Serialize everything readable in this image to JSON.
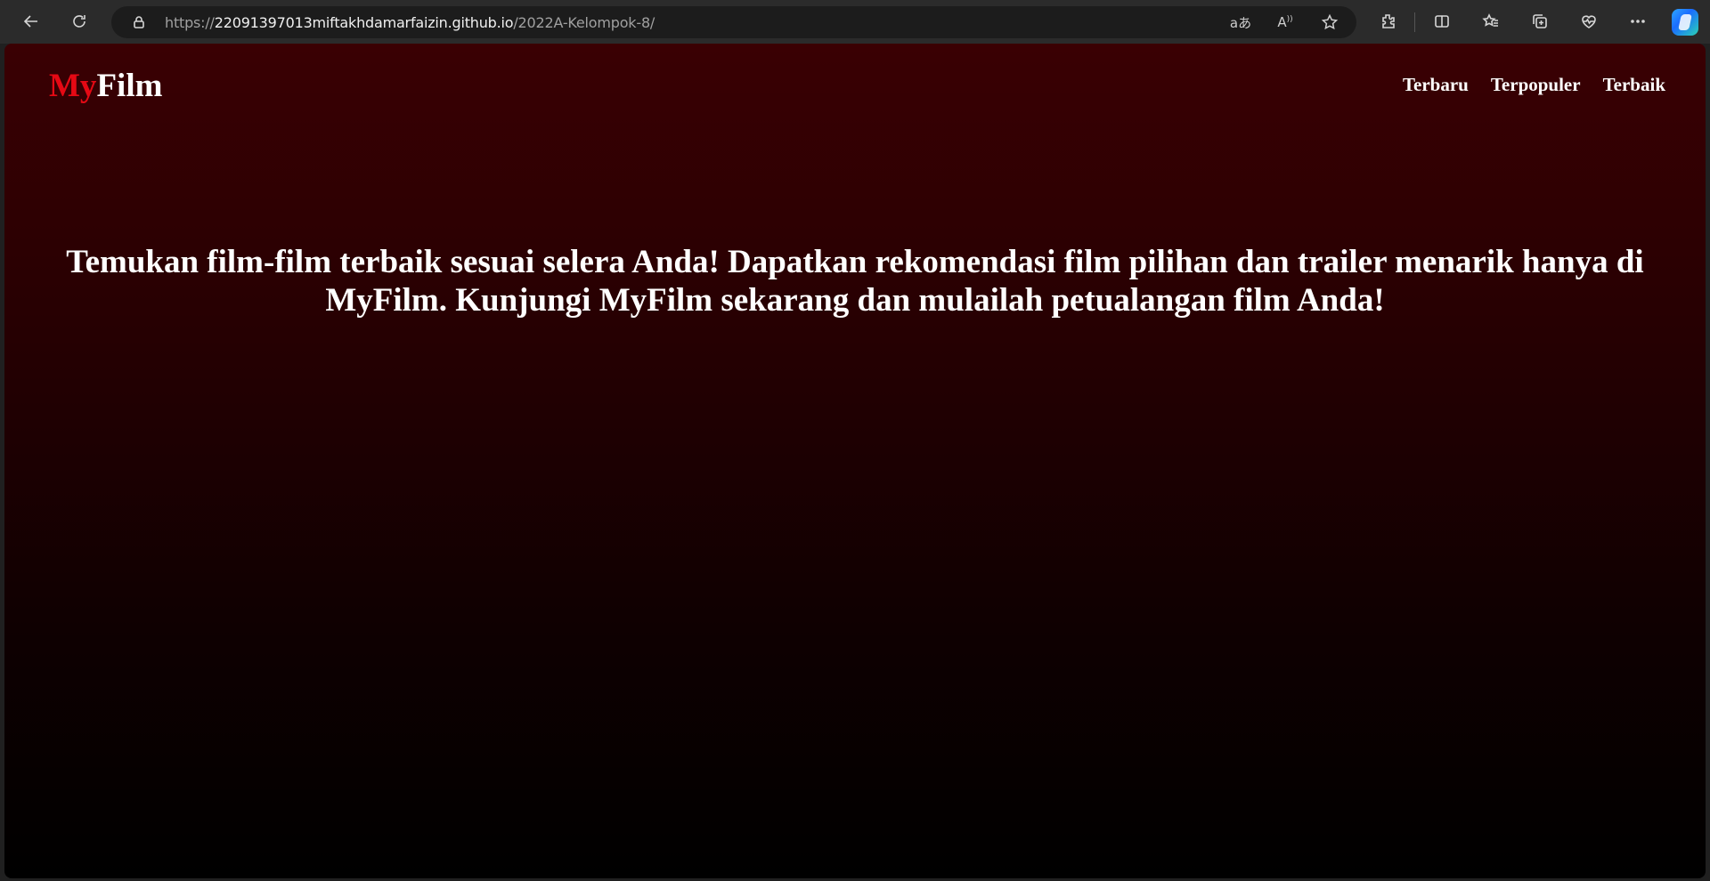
{
  "browser": {
    "url_prefix": "https://",
    "url_host": "22091397013miftakhdamarfaizin.github.io",
    "url_path": "/2022A-Kelompok-8/",
    "icons": [
      "back-icon",
      "reload-icon",
      "lock-icon",
      "translate-icon",
      "read-aloud-icon",
      "favorite-star-icon",
      "extensions-icon",
      "split-screen-icon",
      "favorites-icon",
      "collections-icon",
      "health-icon",
      "more-icon",
      "copilot-icon"
    ]
  },
  "site": {
    "logo_accent": "My",
    "logo_rest": "Film",
    "nav": [
      "Terbaru",
      "Terpopuler",
      "Terbaik"
    ],
    "hero": "Temukan film-film terbaik sesuai selera Anda! Dapatkan rekomendasi film pilihan dan trailer menarik hanya di MyFilm. Kunjungi MyFilm sekarang dan mulailah petualangan film Anda!"
  },
  "colors": {
    "accent": "#e50914",
    "bg_top": "#3a0003",
    "bg_bottom": "#000000",
    "text": "#ffffff"
  }
}
